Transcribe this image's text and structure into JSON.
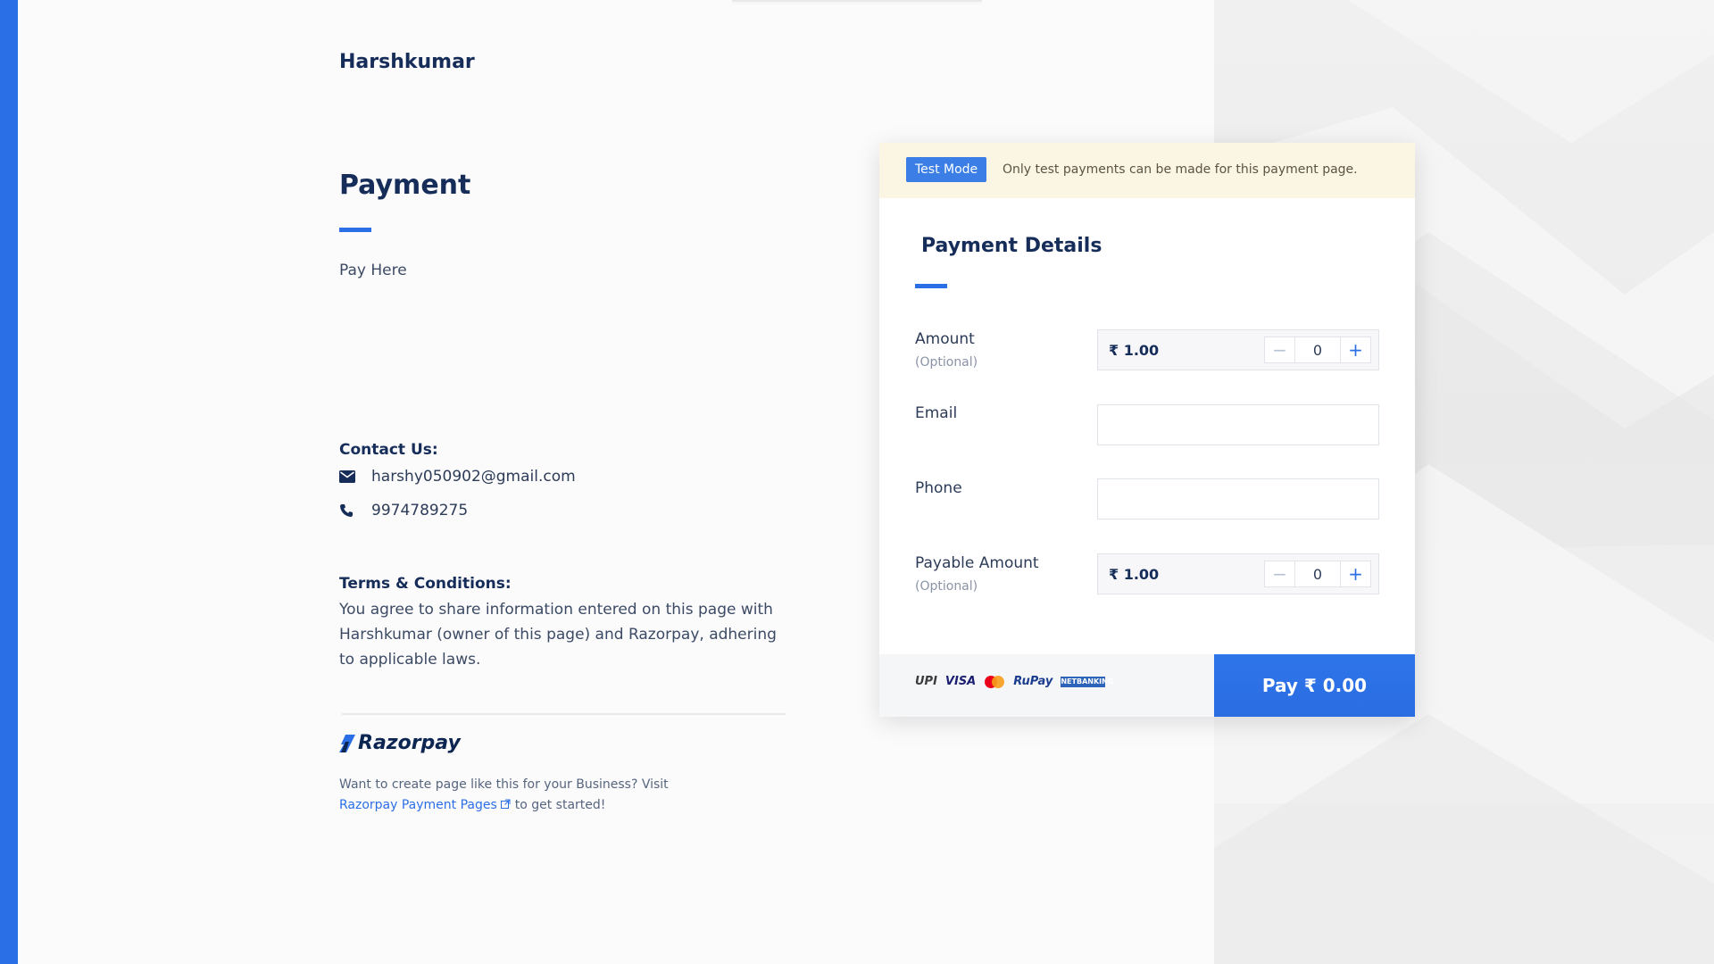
{
  "merchant": {
    "name": "Harshkumar"
  },
  "page": {
    "title": "Payment",
    "description": "Pay Here"
  },
  "contact": {
    "heading": "Contact Us:",
    "email": "harshy050902@gmail.com",
    "phone": "9974789275"
  },
  "terms": {
    "heading": "Terms & Conditions:",
    "text": "You agree to share information entered on this page with Harshkumar (owner of this page) and Razorpay, adhering to applicable laws."
  },
  "branding": {
    "logo_text": "Razorpay",
    "promo_text": "Want to create page like this for your Business? Visit",
    "promo_link": "Razorpay Payment Pages",
    "promo_suffix": "to get started!"
  },
  "test_mode": {
    "badge": "Test Mode",
    "message": "Only test payments can be made for this payment page."
  },
  "form": {
    "title": "Payment Details",
    "amount": {
      "label": "Amount",
      "sub": "(Optional)",
      "value": "₹ 1.00",
      "quantity": "0",
      "minus": "−",
      "plus": "+"
    },
    "email": {
      "label": "Email",
      "value": ""
    },
    "phone": {
      "label": "Phone",
      "value": ""
    },
    "payable": {
      "label": "Payable Amount",
      "sub": "(Optional)",
      "value": "₹ 1.00",
      "quantity": "0",
      "minus": "−",
      "plus": "+"
    }
  },
  "payment_methods": {
    "upi": "UPI",
    "visa": "VISA",
    "rupay": "RuPay",
    "netbanking": "NETBANKING"
  },
  "pay_button": "Pay  ₹ 0.00",
  "colors": {
    "accent": "#2b6fe7",
    "navy": "#162d5a",
    "test_banner_bg": "#fbf6e4"
  }
}
